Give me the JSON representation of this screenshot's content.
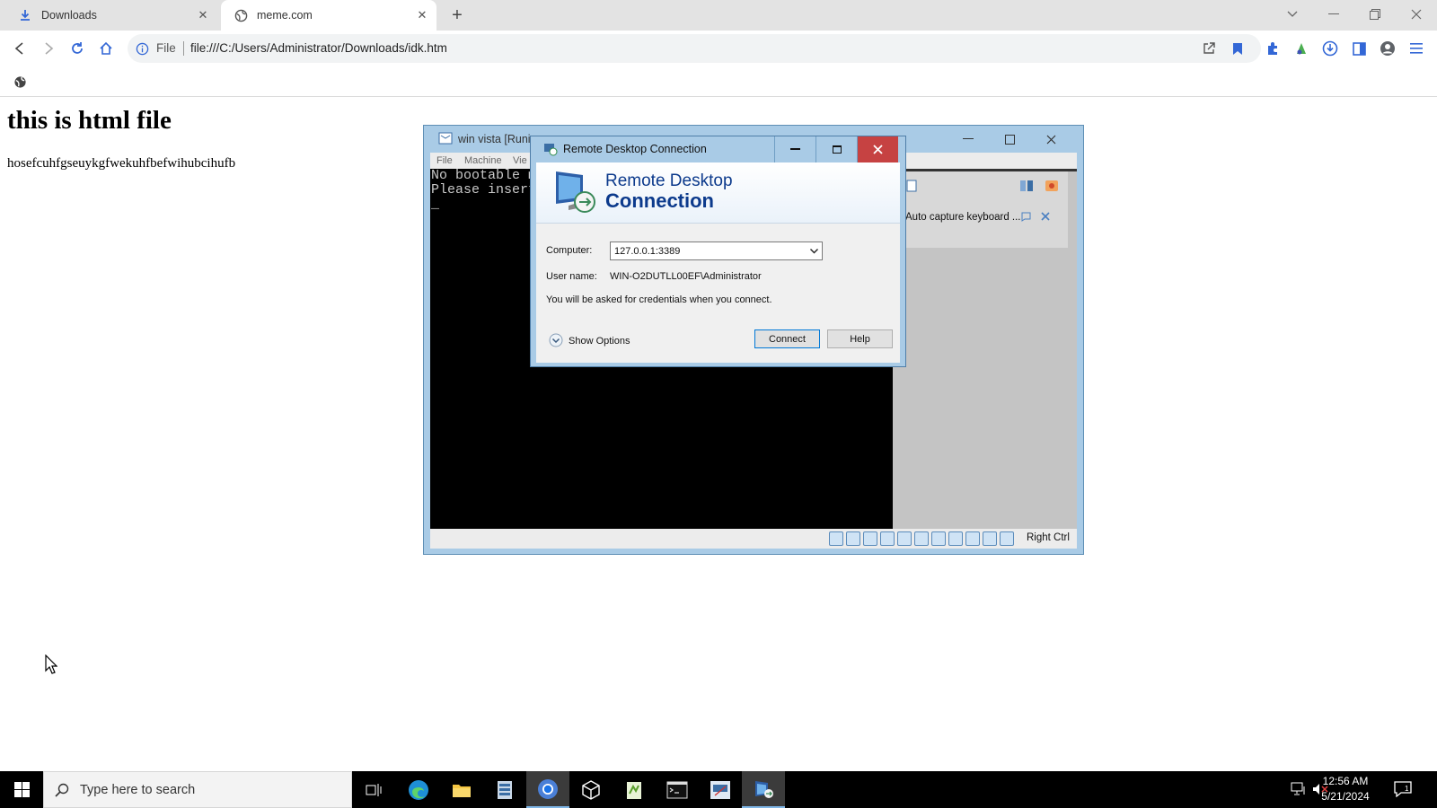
{
  "browser": {
    "tabs": [
      {
        "label": "Downloads",
        "icon": "download-icon"
      },
      {
        "label": "meme.com",
        "icon": "globe-icon"
      }
    ],
    "address_scheme": "File",
    "address_url": "file:///C:/Users/Administrator/Downloads/idk.htm"
  },
  "page": {
    "title": "this is html file",
    "text": "hosefcuhfgseuykgfwekuhfbefwihubcihufb"
  },
  "vbox": {
    "title": "win vista  [Runi",
    "menu": [
      "File",
      "Machine",
      "Vie"
    ],
    "boot_lines": "No bootable m\nPlease insert\n_",
    "side_label": "Auto capture keyboard ...",
    "host_key": "Right Ctrl"
  },
  "rdp": {
    "window_title": "Remote Desktop Connection",
    "banner_line1": "Remote Desktop",
    "banner_line2": "Connection",
    "computer_label": "Computer:",
    "computer_value": "127.0.0.1:3389",
    "username_label": "User name:",
    "username_value": "WIN-O2DUTLL00EF\\Administrator",
    "note": "You will be asked for credentials when you connect.",
    "show_options": "Show Options",
    "connect": "Connect",
    "help": "Help"
  },
  "taskbar": {
    "search_placeholder": "Type here to search",
    "time": "12:56 AM",
    "date": "5/21/2024"
  },
  "colors": {
    "accent": "#0078d7",
    "rdp_heading": "#0c3a8c",
    "window_frame": "#a9cbe6",
    "close_red": "#c64242"
  }
}
